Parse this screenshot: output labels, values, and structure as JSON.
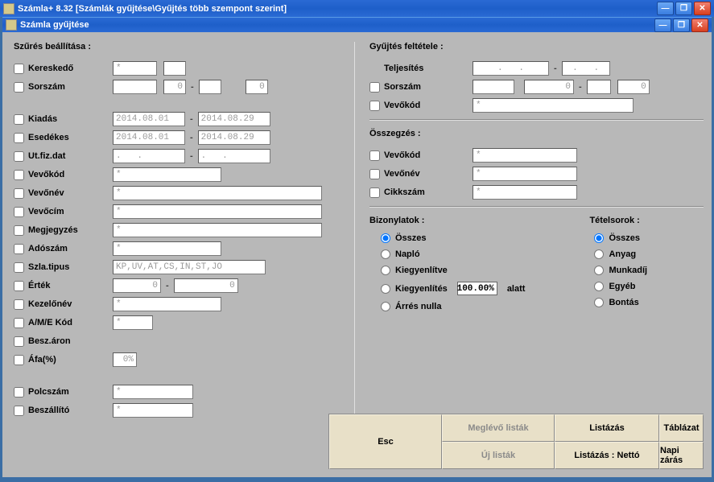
{
  "outer_title": "Számla+ 8.32   [Számlák gyűjtése\\Gyűjtés több szempont szerint]",
  "inner_title": "Számla gyűjtése",
  "left": {
    "section": "Szűrés beállítása :",
    "kereskedo": "Kereskedő",
    "sorszam": "Sorszám",
    "kiadas": "Kiadás",
    "esedekes": "Esedékes",
    "utfizdat": "Ut.fiz.dat",
    "vevokod": "Vevőkód",
    "vevonev": "Vevőnév",
    "vevocim": "Vevőcím",
    "megjegyzes": "Megjegyzés",
    "adoszam": "Adószám",
    "szlatipus": "Szla.tipus",
    "ertek": "Érték",
    "kezelonev": "Kezelőnév",
    "amekod": "A/M/E Kód",
    "beszaron": "Besz.áron",
    "afa": "Áfa(%)",
    "polcszam": "Polcszám",
    "beszallito": "Beszállító",
    "date1a": "2014.08.01",
    "date1b": "2014.08.29",
    "date2a": "2014.08.01",
    "date2b": "2014.08.29",
    "date3a": ".   .",
    "date3b": ".   .",
    "szlatipus_val": "KP,UV,AT,CS,IN,ST,JO",
    "zero": "0",
    "star": "*",
    "afa_val": "0%"
  },
  "right": {
    "section": "Gyűjtés feltétele :",
    "teljesites": "Teljesítés",
    "sorszam": "Sorszám",
    "vevokod": "Vevőkód",
    "osszegzes": "Összegzés :",
    "vevonev": "Vevőnév",
    "cikkszam": "Cikkszám",
    "bizonylatok": "Bizonylatok :",
    "tetelsorok": "Tételsorok :",
    "osszes": "Összes",
    "naplo": "Napló",
    "kiegyenlitve": "Kiegyenlítve",
    "kiegyenlites": "Kiegyenlítés",
    "pct": "100.00%",
    "alatt": "alatt",
    "arresnulla": "Árrés nulla",
    "anyag": "Anyag",
    "munkadij": "Munkadíj",
    "egyeb": "Egyéb",
    "bontas": "Bontás",
    "date_empty": ".   .",
    "zero": "0",
    "star": "*"
  },
  "buttons": {
    "meglevolistak": "Meglévő listák",
    "listazas": "Listázás",
    "tablazat": "Táblázat",
    "ujlistak": "Új listák",
    "listazasnetto": "Listázás : Nettó",
    "napizaras": "Napi zárás",
    "esc": "Esc"
  }
}
